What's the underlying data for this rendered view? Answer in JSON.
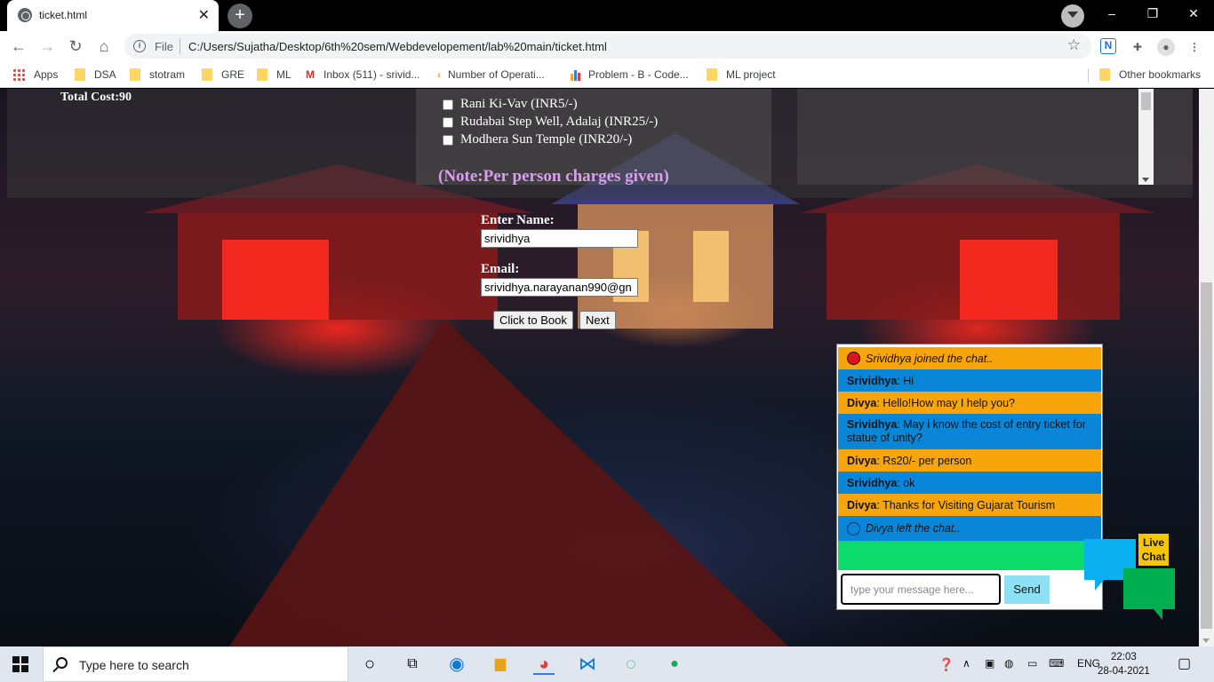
{
  "browser": {
    "tab_title": "ticket.html",
    "tab_close": "✕",
    "newtab": "+",
    "window_controls": [
      "–",
      "❐",
      "✕"
    ],
    "scheme": "File",
    "url": "C:/Users/Sujatha/Desktop/6th%20sem/Webdevelopement/lab%20main/ticket.html",
    "star": "☆",
    "nav": {
      "back": "←",
      "forward": "→",
      "reload": "↻",
      "home": "⌂"
    }
  },
  "bookmarks": [
    {
      "label": "Apps",
      "icon": "apps-grid-icon"
    },
    {
      "label": "DSA",
      "icon": "folder-icon"
    },
    {
      "label": "stotram",
      "icon": "folder-icon"
    },
    {
      "label": "GRE",
      "icon": "folder-icon"
    },
    {
      "label": "ML",
      "icon": "folder-icon"
    },
    {
      "label": "Inbox (511) - srivid...",
      "icon": "gmail-icon"
    },
    {
      "label": "Number of Operati...",
      "icon": "leetcode-icon"
    },
    {
      "label": "Problem - B - Code...",
      "icon": "codeforces-icon"
    },
    {
      "label": "ML project",
      "icon": "folder-icon"
    }
  ],
  "other_bookmarks": "Other bookmarks",
  "page": {
    "total_cost": "Total Cost:90",
    "checkboxes": [
      {
        "label": "Rani Ki-Vav (INR5/-)",
        "checked": false
      },
      {
        "label": "Rudabai Step Well, Adalaj (INR25/-)",
        "checked": false
      },
      {
        "label": "Modhera Sun Temple (INR20/-)",
        "checked": false
      }
    ],
    "note": "(Note:Per person charges given)",
    "name_label": "Enter Name:",
    "name_value": "srividhya",
    "email_label": "Email:",
    "email_value": "srividhya.narayanan990@gn",
    "book_button": "Click to Book",
    "next_button": "Next"
  },
  "chat": {
    "messages": [
      {
        "type": "system",
        "icon": "red-dot-icon",
        "text": "Srividhya joined the chat..",
        "color": "#f7a50a"
      },
      {
        "type": "user",
        "sender": "Srividhya",
        "text": ": Hi",
        "color": "#0a86d8"
      },
      {
        "type": "user",
        "sender": "Divya",
        "text": ": Hello!How may I help you?",
        "color": "#f7a50a"
      },
      {
        "type": "user",
        "sender": "Srividhya",
        "text": ": May i know the cost of entry ticket for statue of unity?",
        "color": "#0a86d8"
      },
      {
        "type": "user",
        "sender": "Divya",
        "text": ": Rs20/- per person",
        "color": "#f7a50a"
      },
      {
        "type": "user",
        "sender": "Srividhya",
        "text": ": ok",
        "color": "#0a86d8"
      },
      {
        "type": "user",
        "sender": "Divya",
        "text": ": Thanks for Visiting Gujarat Tourism",
        "color": "#f7a50a"
      },
      {
        "type": "system",
        "icon": "ring-icon",
        "text": "Divya left the chat..",
        "color": "#0a86d8"
      }
    ],
    "input_placeholder": "type your message here...",
    "send_label": "Send",
    "live_chat_label_1": "Live",
    "live_chat_label_2": "Chat"
  },
  "taskbar": {
    "search_placeholder": "Type here to search",
    "language": "ENG",
    "time": "22:03",
    "date": "28-04-2021"
  }
}
